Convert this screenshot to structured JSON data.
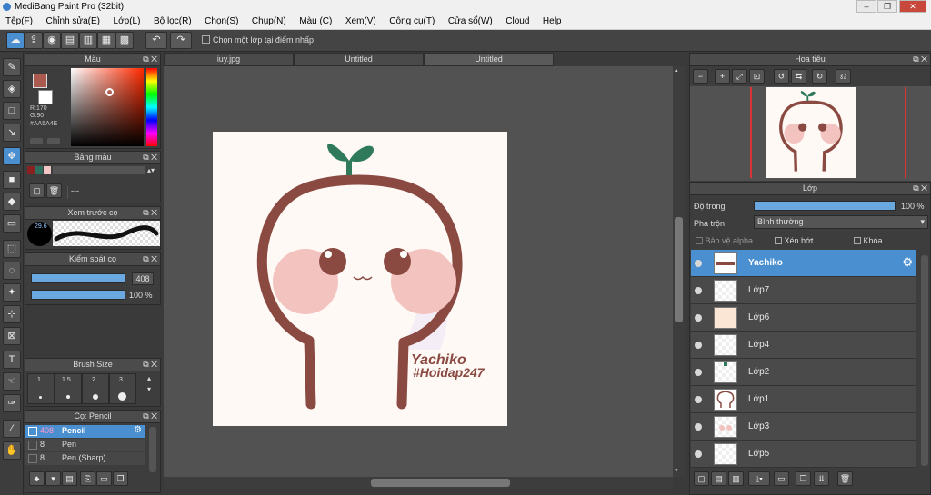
{
  "window": {
    "title": "MediBang Paint Pro (32bit)"
  },
  "menu": [
    "Tệp(F)",
    "Chỉnh sửa(E)",
    "Lớp(L)",
    "Bộ lọc(R)",
    "Chọn(S)",
    "Chụp(N)",
    "Màu (C)",
    "Xem(V)",
    "Công cụ(T)",
    "Cửa sổ(W)",
    "Cloud",
    "Help"
  ],
  "toolbar": {
    "auto_select_label": "Chọn một lớp tại điểm nhấp"
  },
  "color_panel": {
    "title": "Màu",
    "r_label": "R:170",
    "g_label": "G:90",
    "hex_label": "#AA5A4E",
    "primary_color": "#AA5A4E",
    "secondary_color": "#FFFFFF"
  },
  "palette_panel": {
    "title": "Bảng màu",
    "list_label": "---",
    "swatches": [
      "#8b2020",
      "#2e6e5e",
      "#f3c6c6"
    ]
  },
  "brush_preview_panel": {
    "title": "Xem trước cọ",
    "size_label": "29.6"
  },
  "brush_control_panel": {
    "title": "Kiểm soát cọ",
    "size_value": "408",
    "opacity_value": "100 %"
  },
  "brush_size_panel": {
    "title": "Brush Size",
    "sizes": [
      "1",
      "1.5",
      "2",
      "3"
    ]
  },
  "brush_list_panel": {
    "title": "Cọ: Pencil",
    "items": [
      {
        "size": "408",
        "name": "Pencil"
      },
      {
        "size": "8",
        "name": "Pen"
      },
      {
        "size": "8",
        "name": "Pen (Sharp)"
      }
    ]
  },
  "tabs": [
    "iuy.jpg",
    "Untitled",
    "Untitled"
  ],
  "canvas": {
    "watermark_line1": "Yachiko",
    "watermark_line2": "#Hoidap247",
    "colors": {
      "outline": "#8a4a42",
      "leaf": "#2e7a5a",
      "cheek": "#f3c3c0",
      "bg": "#fff9f6"
    }
  },
  "navigator_panel": {
    "title": "Hoa tiêu"
  },
  "layer_panel": {
    "title": "Lớp",
    "opacity_label": "Độ trong",
    "opacity_value": "100 %",
    "opacity_fraction": 1.0,
    "blend_label": "Pha trộn",
    "blend_value": "Bình thường",
    "alpha_protect_label": "Bảo vệ alpha",
    "clip_label": "Xén bớt",
    "lock_label": "Khóa",
    "layers": [
      "Yachiko",
      "Lớp7",
      "Lớp6",
      "Lớp4",
      "Lớp2",
      "Lớp1",
      "Lớp3",
      "Lớp5"
    ]
  }
}
